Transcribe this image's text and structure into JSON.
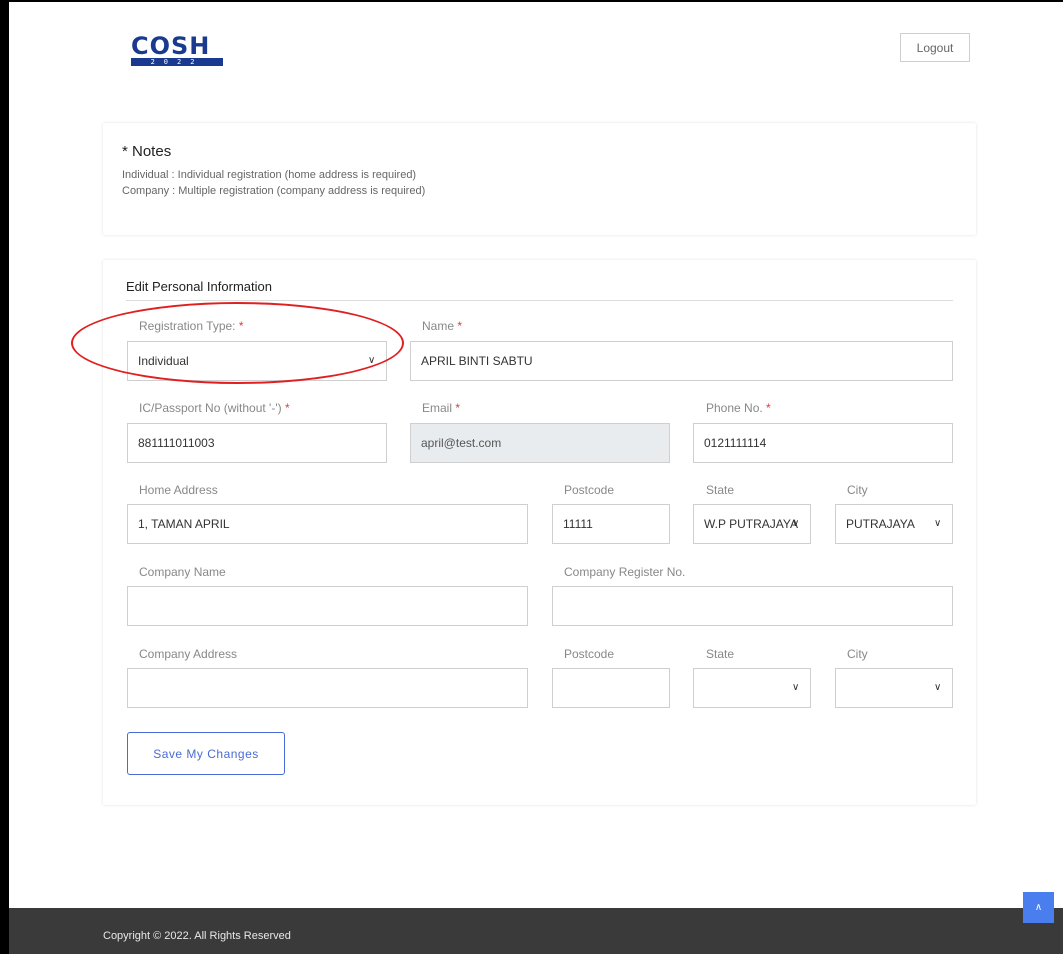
{
  "header": {
    "logo_text": "COSH",
    "logo_year": "2022",
    "logout_label": "Logout"
  },
  "notes": {
    "title": "* Notes",
    "line1": "Individual : Individual registration (home address is required)",
    "line2": "Company : Multiple registration (company address is required)"
  },
  "form": {
    "title": "Edit Personal Information",
    "registration_type": {
      "label": "Registration Type: ",
      "required": "*",
      "value": "Individual"
    },
    "name": {
      "label": "Name ",
      "required": "*",
      "value": "APRIL BINTI SABTU"
    },
    "ic": {
      "label": "IC/Passport No (without '-') ",
      "required": "*",
      "value": "881111011003"
    },
    "email": {
      "label": "Email ",
      "required": "*",
      "value": "april@test.com"
    },
    "phone": {
      "label": "Phone No. ",
      "required": "*",
      "value": "0121111114"
    },
    "home_address": {
      "label": "Home Address",
      "value": "1, TAMAN APRIL"
    },
    "home_postcode": {
      "label": "Postcode",
      "value": "11111"
    },
    "home_state": {
      "label": "State",
      "value": "W.P PUTRAJAYA"
    },
    "home_city": {
      "label": "City",
      "value": "PUTRAJAYA"
    },
    "company_name": {
      "label": "Company Name",
      "value": ""
    },
    "company_reg": {
      "label": "Company Register No.",
      "value": ""
    },
    "company_address": {
      "label": "Company Address",
      "value": ""
    },
    "company_postcode": {
      "label": "Postcode",
      "value": ""
    },
    "company_state": {
      "label": "State",
      "value": ""
    },
    "company_city": {
      "label": "City",
      "value": ""
    },
    "save_label": "Save My Changes"
  },
  "footer": {
    "copyright": "Copyright © 2022. All Rights Reserved",
    "top_icon": "chevron-up-icon"
  },
  "colors": {
    "accent": "#4a6bd6",
    "required": "#e03a3a",
    "annotation": "#e02020",
    "footer_bg": "#3a3a3a",
    "scroll_top_bg": "#4a7dee"
  }
}
